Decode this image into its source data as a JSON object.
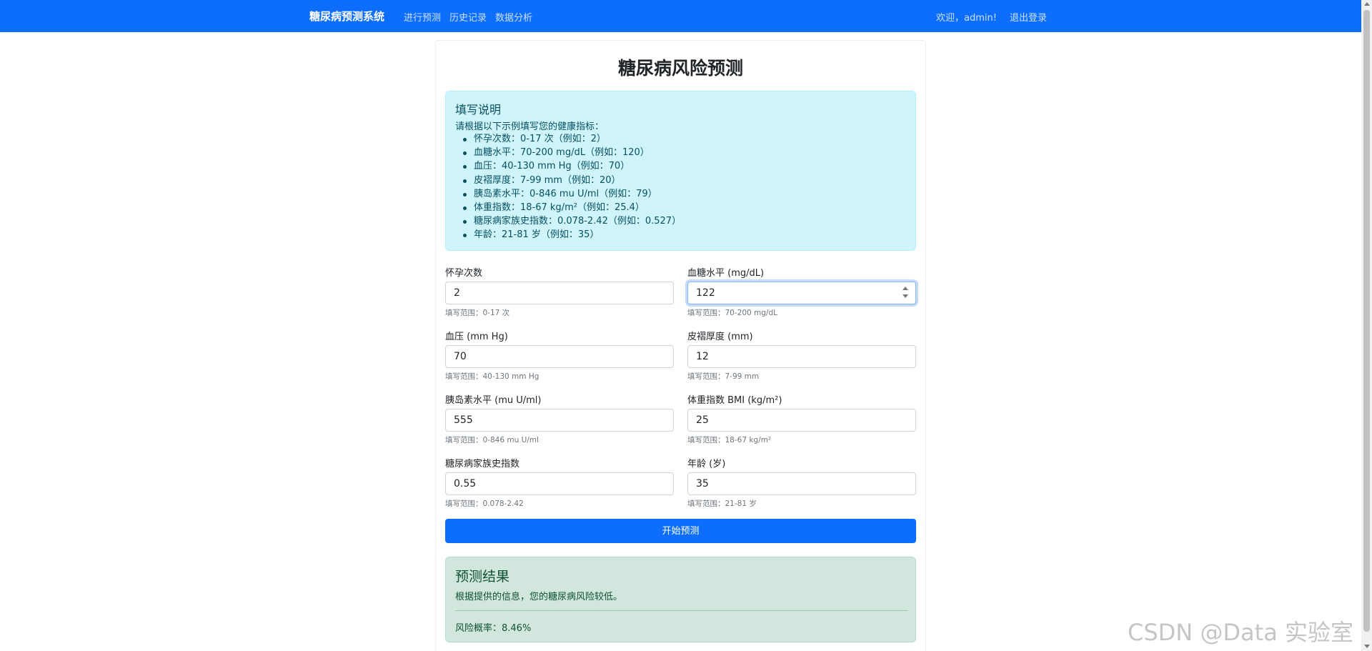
{
  "navbar": {
    "brand": "糖尿病预测系统",
    "links": [
      "进行预测",
      "历史记录",
      "数据分析"
    ],
    "welcome": "欢迎，admin!",
    "logout": "退出登录"
  },
  "page": {
    "title": "糖尿病风险预测"
  },
  "instructions": {
    "title": "填写说明",
    "intro": "请根据以下示例填写您的健康指标：",
    "items": [
      "怀孕次数：0-17 次（例如：2）",
      "血糖水平：70-200 mg/dL（例如：120）",
      "血压：40-130 mm Hg（例如：70）",
      "皮褶厚度：7-99 mm（例如：20）",
      "胰岛素水平：0-846 mu U/ml（例如：79）",
      "体重指数：18-67 kg/m²（例如：25.4）",
      "糖尿病家族史指数：0.078-2.42（例如：0.527）",
      "年龄：21-81 岁（例如：35）"
    ]
  },
  "form": {
    "fields": [
      {
        "label": "怀孕次数",
        "value": "2",
        "hint": "填写范围：0-17 次"
      },
      {
        "label": "血糖水平 (mg/dL)",
        "value": "122",
        "hint": "填写范围：70-200 mg/dL"
      },
      {
        "label": "血压 (mm Hg)",
        "value": "70",
        "hint": "填写范围：40-130 mm Hg"
      },
      {
        "label": "皮褶厚度 (mm)",
        "value": "12",
        "hint": "填写范围：7-99 mm"
      },
      {
        "label": "胰岛素水平 (mu U/ml)",
        "value": "555",
        "hint": "填写范围：0-846 mu U/ml"
      },
      {
        "label": "体重指数 BMI (kg/m²)",
        "value": "25",
        "hint": "填写范围：18-67 kg/m²"
      },
      {
        "label": "糖尿病家族史指数",
        "value": "0.55",
        "hint": "填写范围：0.078-2.42"
      },
      {
        "label": "年龄 (岁)",
        "value": "35",
        "hint": "填写范围：21-81 岁"
      }
    ],
    "submit": "开始预测"
  },
  "result": {
    "title": "预测结果",
    "text": "根据提供的信息，您的糖尿病风险较低。",
    "probability": "风险概率：8.46%"
  },
  "watermark": "CSDN @Data 实验室",
  "colors": {
    "primary": "#0d6efd",
    "info_bg": "#cff4fc",
    "success_bg": "#d1e7dd"
  }
}
